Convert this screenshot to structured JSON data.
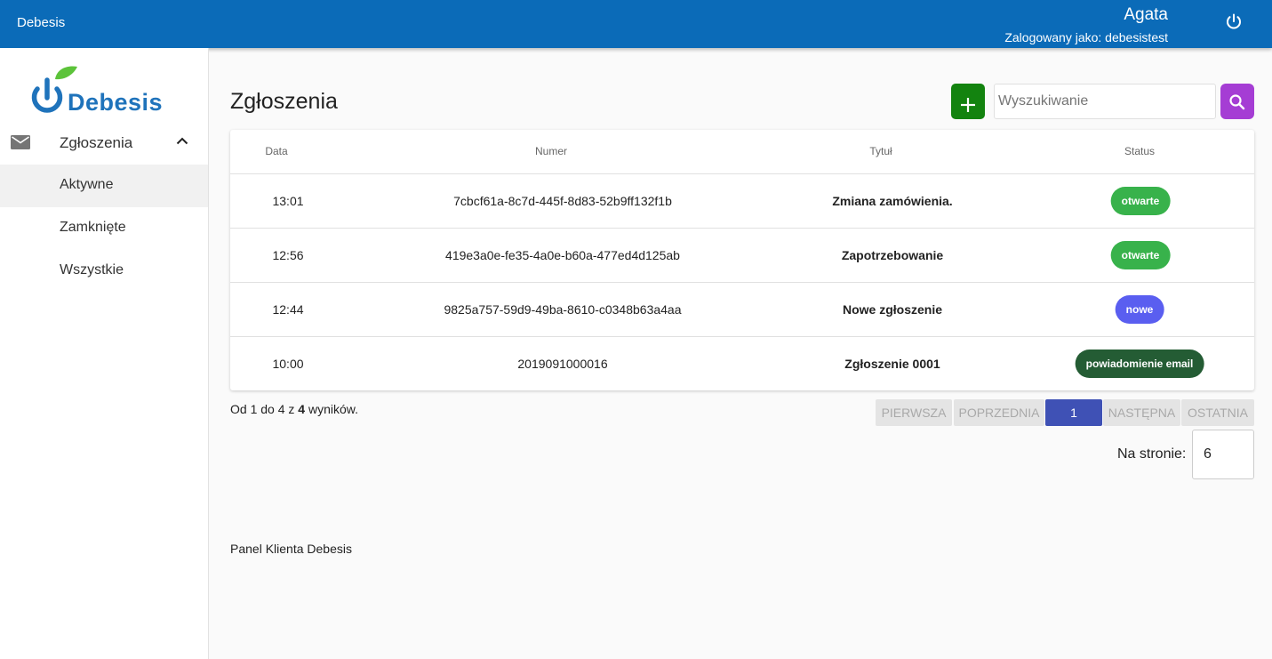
{
  "topbar": {
    "app_title": "Debesis",
    "user_name": "Agata",
    "login_text": "Zalogowany jako: debesistest",
    "power_icon": "power-icon"
  },
  "logo": {
    "text": "Debesis",
    "colors": {
      "blue": "#1f73bb",
      "leaf": "#5cc33a"
    }
  },
  "sidebar": {
    "group_label": "Zgłoszenia",
    "group_icon": "mail-icon",
    "items": [
      {
        "label": "Aktywne",
        "active": true
      },
      {
        "label": "Zamknięte",
        "active": false
      },
      {
        "label": "Wszystkie",
        "active": false
      }
    ]
  },
  "main": {
    "title": "Zgłoszenia",
    "add_icon": "plus-icon",
    "search": {
      "placeholder": "Wyszukiwanie",
      "value": ""
    },
    "search_icon": "search-icon",
    "table": {
      "headers": {
        "date": "Data",
        "number": "Numer",
        "title": "Tytuł",
        "status": "Status"
      },
      "rows": [
        {
          "date": "13:01",
          "number": "7cbcf61a-8c7d-445f-8d83-52b9ff132f1b",
          "title": "Zmiana zamówienia.",
          "status": "otwarte",
          "status_color": "#38b24b"
        },
        {
          "date": "12:56",
          "number": "419e3a0e-fe35-4a0e-b60a-477ed4d125ab",
          "title": "Zapotrzebowanie",
          "status": "otwarte",
          "status_color": "#38b24b"
        },
        {
          "date": "12:44",
          "number": "9825a757-59d9-49ba-8610-c0348b63a4aa",
          "title": "Nowe zgłoszenie",
          "status": "nowe",
          "status_color": "#5a5ef0"
        },
        {
          "date": "10:00",
          "number": "2019091000016",
          "title": "Zgłoszenie 0001",
          "status": "powiadomienie email",
          "status_color": "#245c34"
        }
      ]
    },
    "results": {
      "prefix": "Od 1 do 4 z ",
      "total": "4",
      "suffix": " wyników."
    },
    "pagination": {
      "first": "PIERWSZA",
      "prev": "POPRZEDNIA",
      "current": "1",
      "next": "NASTĘPNA",
      "last": "OSTATNIA"
    },
    "per_page": {
      "label": "Na stronie:",
      "value": "6"
    }
  },
  "footer": {
    "text": "Panel Klienta Debesis"
  },
  "colors": {
    "topbar": "#0b6bb8",
    "add_button": "#13830f",
    "search_button": "#a53dd4",
    "pager_current": "#3f51b5"
  }
}
